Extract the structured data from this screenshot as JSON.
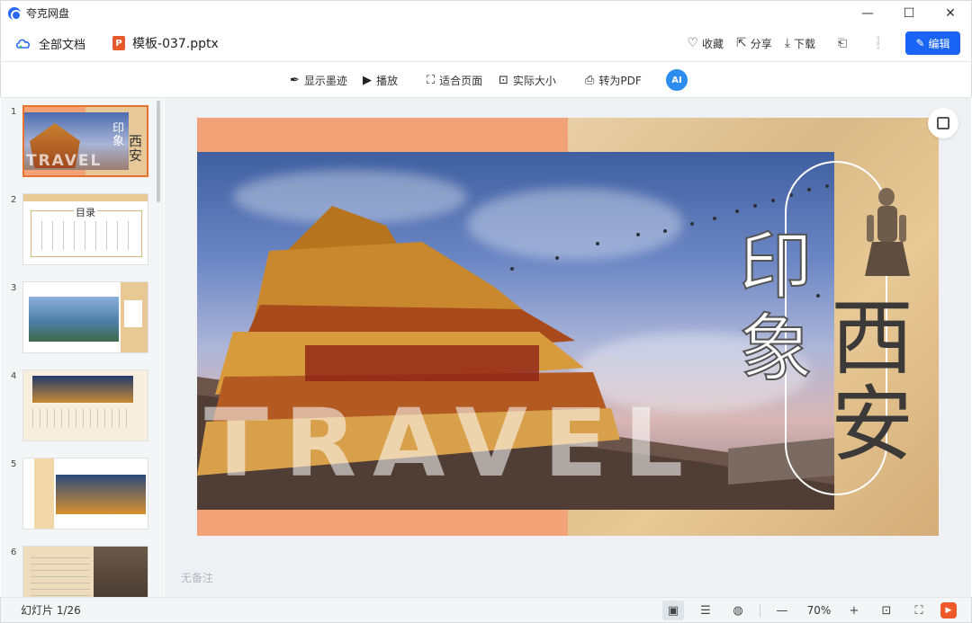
{
  "app": {
    "title": "夸克网盘",
    "controls": {
      "minimize": "—",
      "maximize": "☐",
      "close": "✕"
    }
  },
  "header": {
    "breadcrumb_root": "全部文档",
    "file_badge": "P",
    "file_name": "模板-037.pptx",
    "actions": {
      "favorite": "收藏",
      "share": "分享",
      "download": "下载"
    },
    "edit_label": "编辑"
  },
  "toolbar": {
    "show_ink": "显示墨迹",
    "play": "播放",
    "fit_page": "适合页面",
    "actual_size": "实际大小",
    "to_pdf": "转为PDF",
    "ai_label": "AI"
  },
  "slides": {
    "thumbnails": [
      {
        "number": "1",
        "active": true
      },
      {
        "number": "2",
        "heading": "目录"
      },
      {
        "number": "3"
      },
      {
        "number": "4"
      },
      {
        "number": "5"
      },
      {
        "number": "6"
      }
    ]
  },
  "slide": {
    "title_small": "印象",
    "title_large": "西安",
    "watermark": "TRAVEL",
    "thumb_title_small": "印象",
    "thumb_title_large": "西安",
    "thumb_watermark": "TRAVEL"
  },
  "notes": {
    "placeholder": "无备注"
  },
  "status": {
    "slide_counter": "幻灯片 1/26",
    "zoom": "70%",
    "zoom_out": "—",
    "zoom_in": "+"
  },
  "colors": {
    "accent_blue": "#1a64f5",
    "slide_orange": "#f1a277",
    "slide_sand": "#e7c898",
    "active_thumb_border": "#e8732e"
  }
}
